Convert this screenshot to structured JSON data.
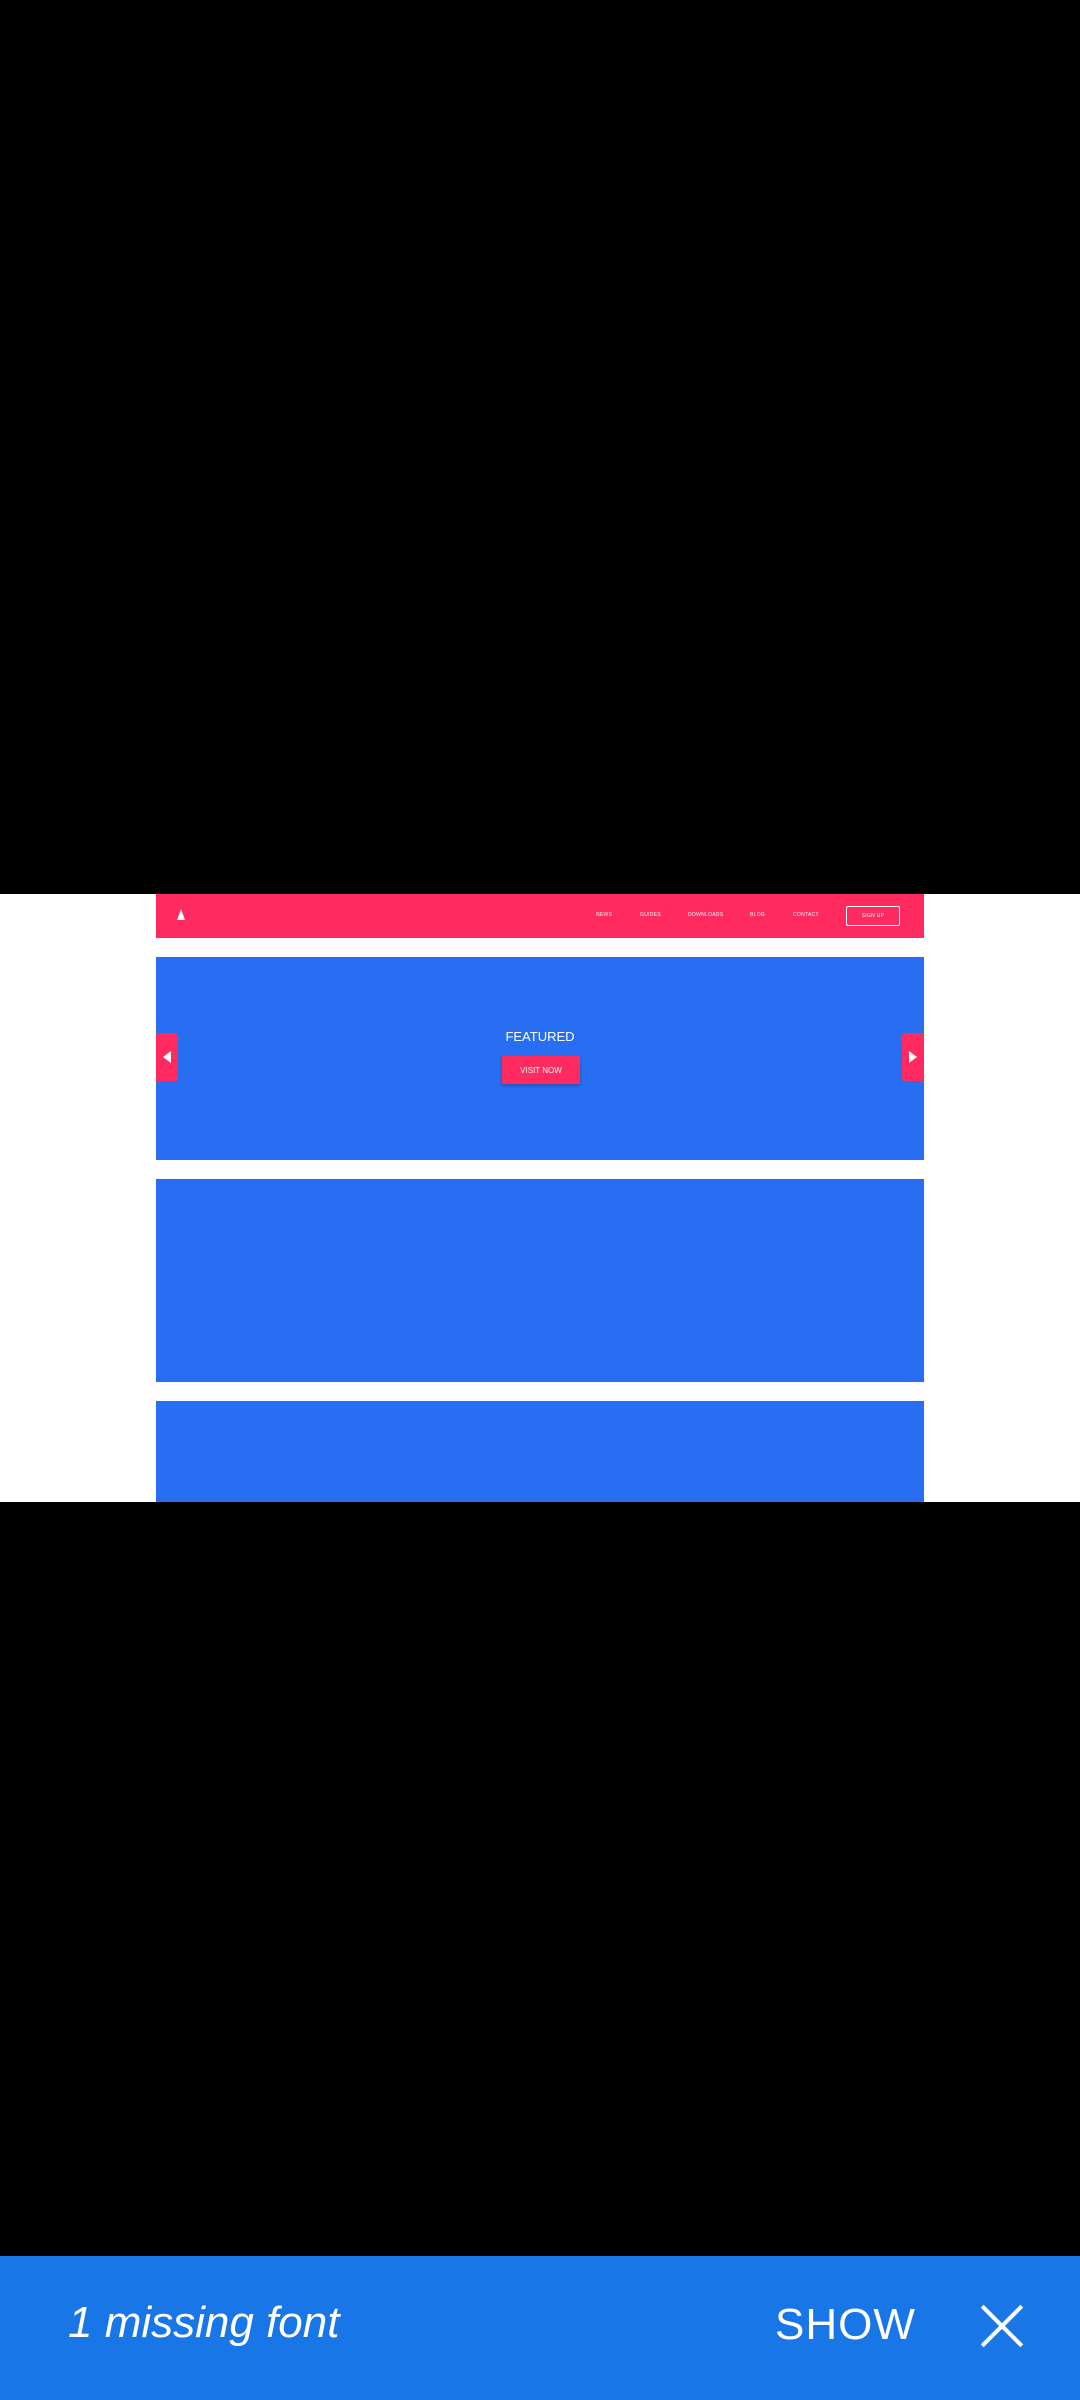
{
  "navbar": {
    "links": [
      "NEWS",
      "GUIDES",
      "DOWNLOADS",
      "BLOG",
      "CONTACT"
    ],
    "signup_label": "SIGN UP",
    "logo_icon": "logo-triangle-icon"
  },
  "hero": {
    "title": "FEATURED",
    "cta_label": "VISIT NOW",
    "prev_icon": "arrow-left-icon",
    "next_icon": "arrow-right-icon"
  },
  "colors": {
    "accent": "#ff2a5f",
    "section": "#286ef2",
    "banner": "#1976e6"
  },
  "banner": {
    "message": "1 missing font",
    "show_label": "SHOW",
    "close_icon": "close-icon"
  }
}
